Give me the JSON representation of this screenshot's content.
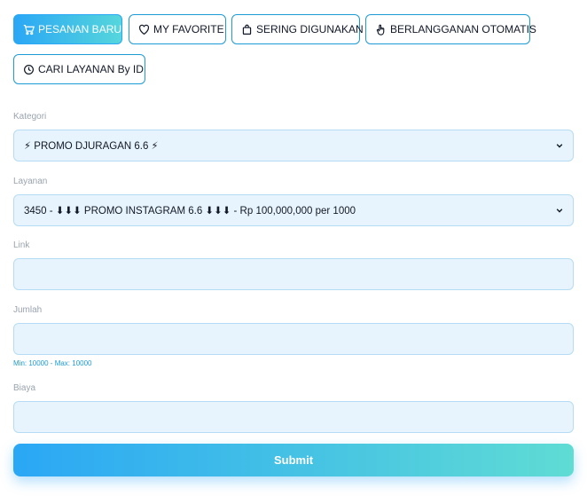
{
  "tabs": [
    {
      "label": "PESANAN BARU",
      "icon": "cart-icon",
      "active": true
    },
    {
      "label": "MY FAVORITE",
      "icon": "heart-icon",
      "active": false
    },
    {
      "label": "SERING DIGUNAKAN",
      "icon": "bag-icon",
      "active": false
    },
    {
      "label": "BERLANGGANAN OTOMATIS",
      "icon": "hand-pointer-icon",
      "active": false
    },
    {
      "label": "CARI LAYANAN By ID",
      "icon": "clock-icon",
      "active": false
    }
  ],
  "form": {
    "kategori_label": "Kategori",
    "kategori_value": "⚡ PROMO DJURAGAN 6.6 ⚡",
    "layanan_label": "Layanan",
    "layanan_value": "3450 - ⬇⬇⬇ PROMO INSTAGRAM 6.6 ⬇⬇⬇ - Rp 100,000,000 per 1000",
    "link_label": "Link",
    "link_value": "",
    "jumlah_label": "Jumlah",
    "jumlah_value": "",
    "jumlah_hint": "Min: 10000 - Max: 10000",
    "biaya_label": "Biaya",
    "biaya_value": "",
    "submit_label": "Submit"
  },
  "colors": {
    "accent": "#1d9bd6",
    "gradient_start": "#2aa7f5",
    "gradient_end": "#56d6dc",
    "field_bg": "#e8f4fd"
  }
}
